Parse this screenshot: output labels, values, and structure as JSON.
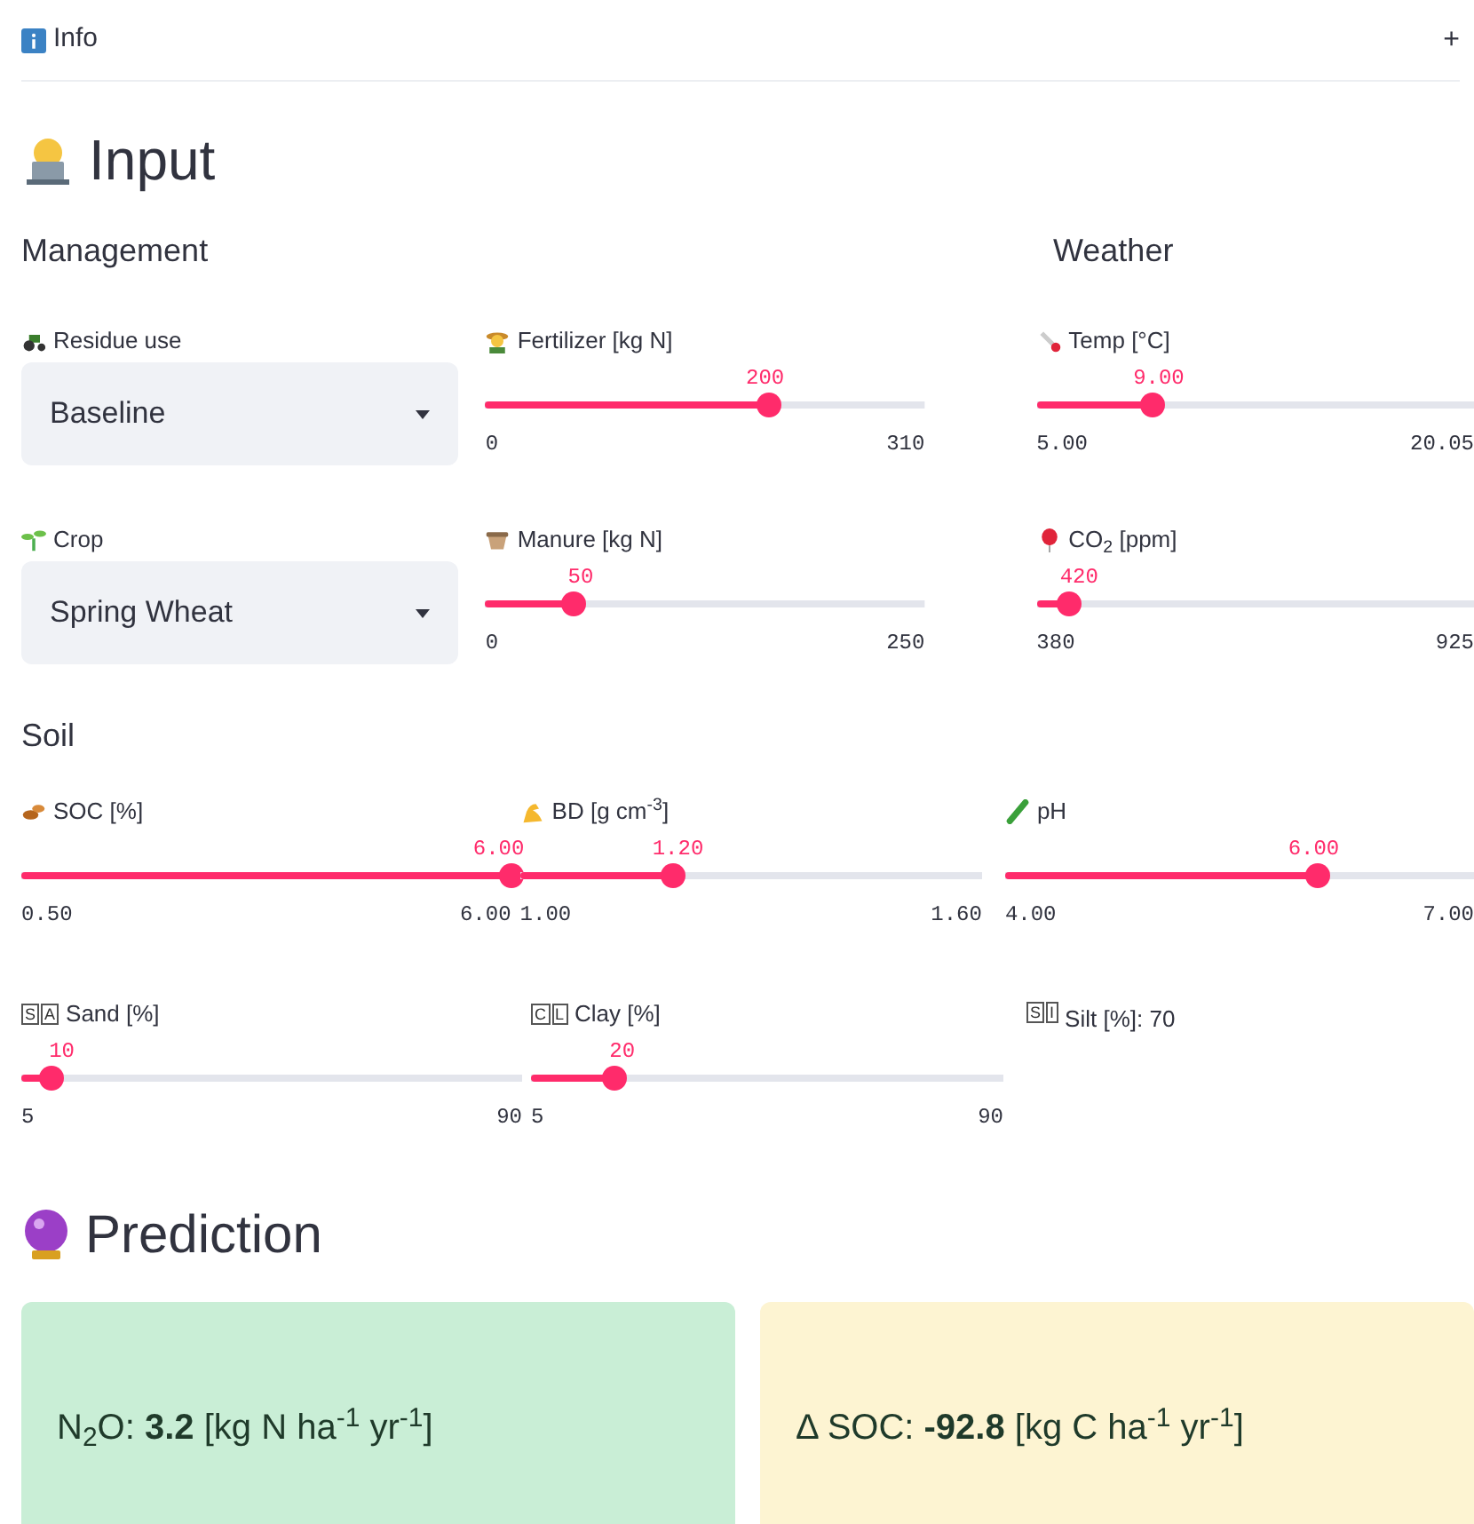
{
  "info": {
    "label": "Info",
    "toggle": "+"
  },
  "input": {
    "title": "Input",
    "management_title": "Management",
    "weather_title": "Weather",
    "selects": [
      {
        "label": "Residue use",
        "value": "Baseline"
      },
      {
        "label": "Crop",
        "value": "Spring Wheat"
      }
    ],
    "management_sliders": [
      {
        "label": "Fertilizer [kg N]",
        "value": "200",
        "min": "0",
        "max": "310",
        "level": 0.645
      },
      {
        "label": "Manure [kg N]",
        "value": "50",
        "min": "0",
        "max": "250",
        "level": 0.2
      }
    ],
    "weather_sliders": [
      {
        "label": "Temp [°C]",
        "value": "9.00",
        "min": "5.00",
        "max": "20.05",
        "level": 0.266
      },
      {
        "label": "CO$_{2}$ [ppm]",
        "value": "420",
        "min": "380",
        "max": "925",
        "level": 0.073
      }
    ],
    "soil_title": "Soil",
    "soil_sliders": [
      {
        "label": "SOC [%]",
        "value": "6.00",
        "min": "0.50",
        "max": "6.00",
        "level": 1.0
      },
      {
        "label": "BD [g cm$^{-3}$]",
        "value": "1.20",
        "min": "1.00",
        "max": "1.60",
        "level": 0.333
      },
      {
        "label": "pH",
        "value": "6.00",
        "min": "4.00",
        "max": "7.00",
        "level": 0.667
      }
    ],
    "texture": [
      {
        "kind": "slider",
        "badge": [
          "S",
          "A"
        ],
        "label": "Sand [%]",
        "value": "10",
        "min": "5",
        "max": "90",
        "level": 0.059
      },
      {
        "kind": "slider",
        "badge": [
          "C",
          "L"
        ],
        "label": "Clay [%]",
        "value": "20",
        "min": "5",
        "max": "90",
        "level": 0.176
      },
      {
        "kind": "readout",
        "badge": [
          "S",
          "I"
        ],
        "label": "Silt [%]: 70"
      }
    ]
  },
  "prediction": {
    "title": "Prediction",
    "cards": [
      {
        "text": "N$_{2}$O: **3.2** [kg N ha$^{-1}$ yr$^{-1}$]",
        "color": "#c9eed6"
      },
      {
        "text": "Δ SOC: **-92.8** [kg C ha$^{-1}$ yr$^{-1}$]",
        "color": "#fdf4d2"
      }
    ]
  }
}
